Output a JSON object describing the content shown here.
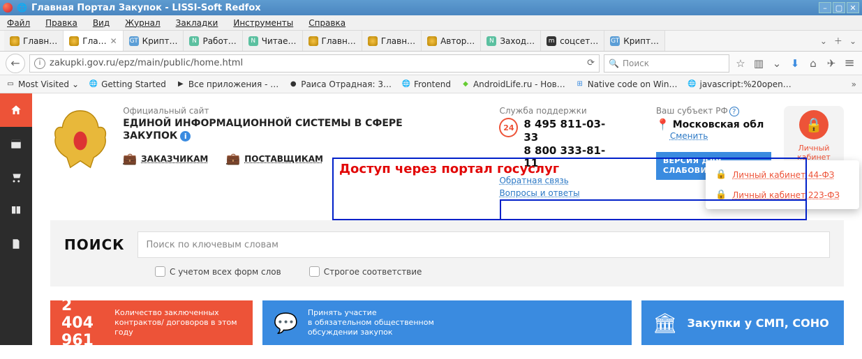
{
  "window": {
    "title": "Главная Портал Закупок - LISSI-Soft Redfox"
  },
  "menu": {
    "file": "Файл",
    "edit": "Правка",
    "view": "Вид",
    "journal": "Журнал",
    "bookmarks": "Закладки",
    "tools": "Инструменты",
    "help": "Справка"
  },
  "tabs": [
    {
      "label": "Главн…",
      "fav": "eagle"
    },
    {
      "label": "Гла…",
      "fav": "eagle",
      "active": true
    },
    {
      "label": "Крипт…",
      "fav": "gt"
    },
    {
      "label": "Работ…",
      "fav": "n"
    },
    {
      "label": "Читае…",
      "fav": "n"
    },
    {
      "label": "Главн…",
      "fav": "eagle"
    },
    {
      "label": "Главн…",
      "fav": "eagle"
    },
    {
      "label": "Автор…",
      "fav": "eagle"
    },
    {
      "label": "Заход…",
      "fav": "n"
    },
    {
      "label": "соцсет…",
      "fav": "m"
    },
    {
      "label": "Крипт…",
      "fav": "gt"
    }
  ],
  "url": "zakupki.gov.ru/epz/main/public/home.html",
  "search_placeholder": "Поиск",
  "bookmarks": [
    {
      "label": "Most Visited"
    },
    {
      "label": "Getting Started"
    },
    {
      "label": "Все приложения - …"
    },
    {
      "label": "Раиса Отрадная: 3…"
    },
    {
      "label": "Frontend"
    },
    {
      "label": "AndroidLife.ru - Нов…"
    },
    {
      "label": "Native code on Win…"
    },
    {
      "label": "javascript:%20open…"
    }
  ],
  "site": {
    "official": "Официальный сайт",
    "main_title": "ЕДИНОЙ ИНФОРМАЦИОННОЙ СИСТЕМЫ В СФЕРЕ ЗАКУПОК",
    "role_customers": "ЗАКАЗЧИКАМ",
    "role_suppliers": "ПОСТАВЩИКАМ",
    "support_label": "Служба поддержки",
    "badge24": "24",
    "phone1": "8 495 811-03-33",
    "phone2": "8 800 333-81-11",
    "link_feedback": "Обратная связь",
    "link_faq": "Вопросы и ответы",
    "subject_label": "Ваш субъект РФ",
    "region": "Московская обл",
    "change": "Сменить",
    "access_line1": "ВЕРСИЯ ДЛЯ",
    "access_line2": "СЛАБОВИДЯЩИХ",
    "cabinet": "Личный кабинет",
    "dropdown1": "Личный кабинет 44-ФЗ",
    "dropdown2": "Личный кабинет 223-ФЗ",
    "annotation": "Доступ через портал госуслуг",
    "search_heading": "ПОИСК",
    "search_ph": "Поиск по ключевым словам",
    "chk_forms": "С учетом всех форм слов",
    "chk_strict": "Строгое соответствие",
    "stat_number": "2 404 961",
    "stat_label": "Количество заключенных контрактов/ договоров в этом году",
    "card2_l1": "Принять участие",
    "card2_l2": "в обязательном общественном",
    "card2_l3": "обсуждении закупок",
    "card3": "Закупки у СМП, СОНО"
  }
}
